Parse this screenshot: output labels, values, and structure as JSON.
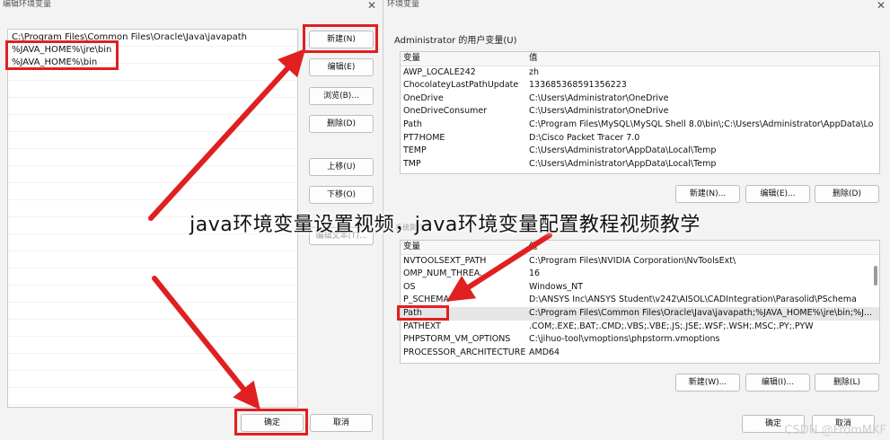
{
  "left_dialog": {
    "title": "编辑环境变量",
    "close_glyph": "✕",
    "path_entries": [
      "C:\\Program Files\\Common Files\\Oracle\\Java\\javapath",
      "%JAVA_HOME%\\jre\\bin",
      "%JAVA_HOME%\\bin"
    ],
    "buttons": {
      "new": "新建(N)",
      "edit": "编辑(E)",
      "browse": "浏览(B)...",
      "delete": "删除(D)",
      "move_up": "上移(U)",
      "move_down": "下移(O)",
      "edit_text": "编辑文本(T)...",
      "ok": "确定",
      "cancel": "取消"
    }
  },
  "right_dialog": {
    "title": "环境变量",
    "close_glyph": "✕",
    "system_dialog_ghost_title": "系统属性",
    "user_vars": {
      "label": "Administrator 的用户变量(U)",
      "col_var": "变量",
      "col_val": "值",
      "rows": [
        {
          "name": "AWP_LOCALE242",
          "value": "zh"
        },
        {
          "name": "ChocolateyLastPathUpdate",
          "value": "133685368591356223"
        },
        {
          "name": "OneDrive",
          "value": "C:\\Users\\Administrator\\OneDrive"
        },
        {
          "name": "OneDriveConsumer",
          "value": "C:\\Users\\Administrator\\OneDrive"
        },
        {
          "name": "Path",
          "value": "C:\\Program Files\\MySQL\\MySQL Shell 8.0\\bin\\;C:\\Users\\Administrator\\AppData\\Loc..."
        },
        {
          "name": "PT7HOME",
          "value": "D:\\Cisco Packet Tracer 7.0"
        },
        {
          "name": "TEMP",
          "value": "C:\\Users\\Administrator\\AppData\\Local\\Temp"
        },
        {
          "name": "TMP",
          "value": "C:\\Users\\Administrator\\AppData\\Local\\Temp"
        }
      ],
      "buttons": {
        "new": "新建(N)...",
        "edit": "编辑(E)...",
        "delete": "删除(D)"
      }
    },
    "system_vars": {
      "col_var": "变量",
      "col_val": "值",
      "rows": [
        {
          "name": "NVTOOLSEXT_PATH",
          "value": "C:\\Program Files\\NVIDIA Corporation\\NvToolsExt\\"
        },
        {
          "name": "OMP_NUM_THREA...",
          "value": "16"
        },
        {
          "name": "OS",
          "value": "Windows_NT"
        },
        {
          "name": "P_SCHEMA",
          "value": "D:\\ANSYS Inc\\ANSYS Student\\v242\\AISOL\\CADIntegration\\Parasolid\\PSchema"
        },
        {
          "name": "Path",
          "value": "C:\\Program Files\\Common Files\\Oracle\\Java\\javapath;%JAVA_HOME%\\jre\\bin;%J..."
        },
        {
          "name": "PATHEXT",
          "value": ".COM;.EXE;.BAT;.CMD;.VBS;.VBE;.JS;.JSE;.WSF;.WSH;.MSC;.PY;.PYW"
        },
        {
          "name": "PHPSTORM_VM_OPTIONS",
          "value": "C:\\jihuo-tool\\vmoptions\\phpstorm.vmoptions"
        },
        {
          "name": "PROCESSOR_ARCHITECTURE",
          "value": "AMD64"
        }
      ],
      "buttons": {
        "new": "新建(W)...",
        "edit": "编辑(I)...",
        "delete": "删除(L)"
      }
    },
    "ok": "确定",
    "cancel": "取消"
  },
  "overlay": {
    "caption": "java环境变量设置视频，java环境变量配置教程视频教学",
    "watermark": "CSDN @FromMKF"
  },
  "colors": {
    "highlight_red": "#e02020"
  }
}
